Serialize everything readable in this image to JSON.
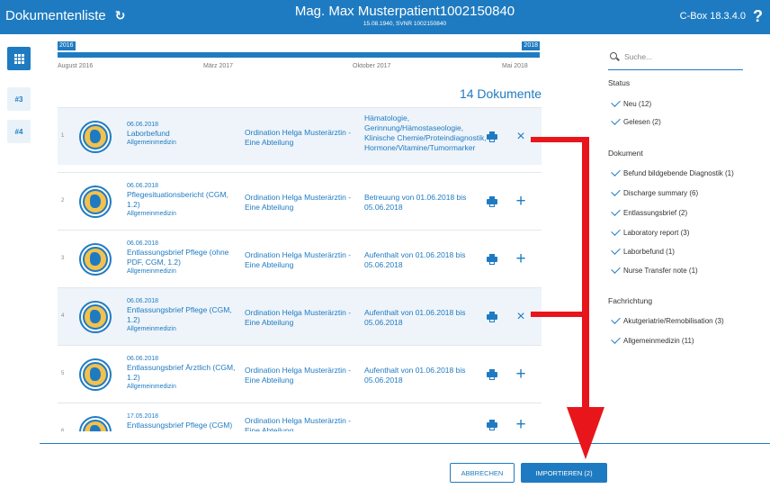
{
  "header": {
    "title": "Dokumentenliste",
    "patient_name": "Mag. Max Musterpatient1002150840",
    "patient_sub": "15.08.1940, SVNR 1002150840",
    "version": "C-Box 18.3.4.0",
    "help": "?"
  },
  "left_sidebar": {
    "item_1": "#3",
    "item_2": "#4"
  },
  "timeline": {
    "year_start": "2016",
    "year_end": "2018",
    "labels": [
      "August 2016",
      "März 2017",
      "Oktober 2017",
      "Mai 2018"
    ]
  },
  "doc_count": "14 Dokumente",
  "documents": [
    {
      "num": "1",
      "date": "06.06.2018",
      "title": "Laborbefund",
      "dept": "Allgemeinmedizin",
      "org": "Ordination Helga Musterärztin - Eine Abteilung",
      "desc": "Hämatologie, Gerinnung/Hämostaseologie, Klinische Chemie/Proteindiagnostik, Hormone/Vitamine/Tumormarker",
      "action": "×"
    },
    {
      "num": "2",
      "date": "06.06.2018",
      "title": "Pflegesituationsbericht (CGM, 1.2)",
      "dept": "Allgemeinmedizin",
      "org": "Ordination Helga Musterärztin - Eine Abteilung",
      "desc": "Betreuung von 01.06.2018 bis 05.06.2018",
      "action": "+"
    },
    {
      "num": "3",
      "date": "06.06.2018",
      "title": "Entlassungsbrief Pflege (ohne PDF, CGM, 1.2)",
      "dept": "Allgemeinmedizin",
      "org": "Ordination Helga Musterärztin - Eine Abteilung",
      "desc": "Aufenthalt von 01.06.2018 bis 05.06.2018",
      "action": "+"
    },
    {
      "num": "4",
      "date": "06.06.2018",
      "title": "Entlassungsbrief Pflege (CGM, 1.2)",
      "dept": "Allgemeinmedizin",
      "org": "Ordination Helga Musterärztin - Eine Abteilung",
      "desc": "Aufenthalt von 01.06.2018 bis 05.06.2018",
      "action": "×"
    },
    {
      "num": "5",
      "date": "06.06.2018",
      "title": "Entlassungsbrief Ärztlich (CGM, 1.2)",
      "dept": "Allgemeinmedizin",
      "org": "Ordination Helga Musterärztin - Eine Abteilung",
      "desc": "Aufenthalt von 01.06.2018 bis 05.06.2018",
      "action": "+"
    },
    {
      "num": "6",
      "date": "17.05.2018",
      "title": "Entlassungsbrief Pflege (CGM)",
      "dept": "",
      "org": "Ordination Helga Musterärztin - Eine Abteilung",
      "desc": "",
      "action": "+"
    }
  ],
  "filters": {
    "search_placeholder": "Suche...",
    "status_title": "Status",
    "status": [
      "Neu (12)",
      "Gelesen (2)"
    ],
    "document_title": "Dokument",
    "document": [
      "Befund bildgebende Diagnostik (1)",
      "Discharge summary (6)",
      "Entlassungsbrief (2)",
      "Laboratory report (3)",
      "Laborbefund (1)",
      "Nurse Transfer note (1)"
    ],
    "fachrichtung_title": "Fachrichtung",
    "fachrichtung": [
      "Akutgeriatrie/Remobilisation (3)",
      "Allgemeinmedizin (11)"
    ]
  },
  "footer": {
    "cancel": "ABBRECHEN",
    "import": "IMPORTIEREN (2)"
  },
  "colors": {
    "brand": "#1f7bc1",
    "selected_row": "#eef4fa",
    "annotation": "#e8161b"
  }
}
